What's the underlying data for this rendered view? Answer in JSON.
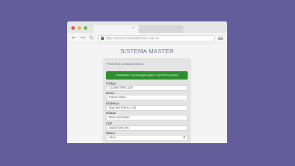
{
  "browser": {
    "url": "http://www.nomedodominio.com.br",
    "back_icon": "back-arrow-icon",
    "forward_icon": "forward-arrow-icon",
    "reload_icon": "reload-icon",
    "menu_icon": "hamburger-menu-icon",
    "tab_close_glyph": "×",
    "nav_glyphs": {
      "back": "←",
      "forward": "→",
      "reload": "↻"
    }
  },
  "page": {
    "title": "SISTEMA MASTER",
    "description": "Preencha os dados abaixo",
    "submit_label": "Cadastrar e prosseguir para o próximo passo",
    "colors": {
      "background": "#635d9a",
      "button": "#2f8f2f",
      "title": "#6f7799"
    }
  },
  "form": {
    "fields": [
      {
        "label": "Código",
        "value": "12345678901234"
      },
      {
        "label": "Nome",
        "value": "Fulano Silva"
      },
      {
        "label": "Endereço",
        "value": "Rua das Flores 123"
      },
      {
        "label": "Cidade",
        "value": "Belo Horizonte"
      },
      {
        "label": "CEP",
        "value": "30000-000 MG"
      },
      {
        "label": "Status",
        "value": "Ativo",
        "type": "select"
      }
    ],
    "select_arrow": "⇕"
  }
}
